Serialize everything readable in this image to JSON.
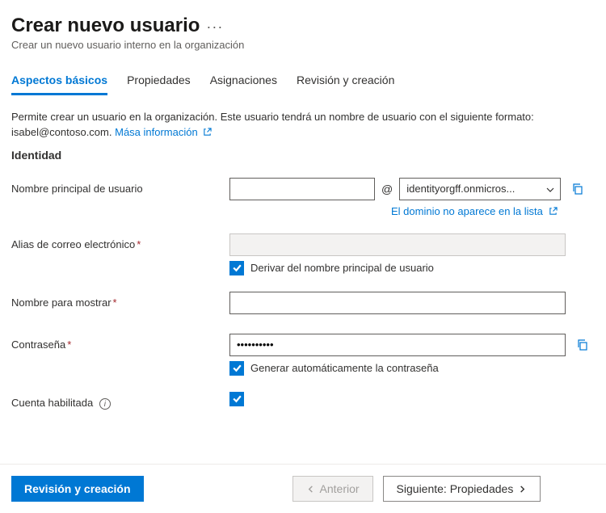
{
  "header": {
    "title": "Crear nuevo usuario",
    "subtitle": "Crear un nuevo usuario interno en la organización"
  },
  "tabs": [
    {
      "label": "Aspectos básicos",
      "active": true
    },
    {
      "label": "Propiedades",
      "active": false
    },
    {
      "label": "Asignaciones",
      "active": false
    },
    {
      "label": "Revisión y creación",
      "active": false
    }
  ],
  "description": {
    "text": "Permite crear un usuario en la organización. Este usuario tendrá un nombre de usuario con el siguiente formato: isabel@contoso.com.",
    "link": "Mása información"
  },
  "section": "Identidad",
  "fields": {
    "upn": {
      "label": "Nombre principal de usuario",
      "value": "",
      "at": "@",
      "domain": "identityorgff.onmicros...",
      "domain_missing": "El dominio no aparece en la lista"
    },
    "alias": {
      "label": "Alias de correo electrónico",
      "value": "",
      "derive_label": "Derivar del nombre principal de usuario"
    },
    "display_name": {
      "label": "Nombre para mostrar",
      "value": ""
    },
    "password": {
      "label": "Contraseña",
      "value": "••••••••••",
      "auto_label": "Generar automáticamente la contraseña"
    },
    "enabled": {
      "label": "Cuenta habilitada"
    }
  },
  "footer": {
    "review": "Revisión y creación",
    "prev": "Anterior",
    "next": "Siguiente: Propiedades"
  }
}
